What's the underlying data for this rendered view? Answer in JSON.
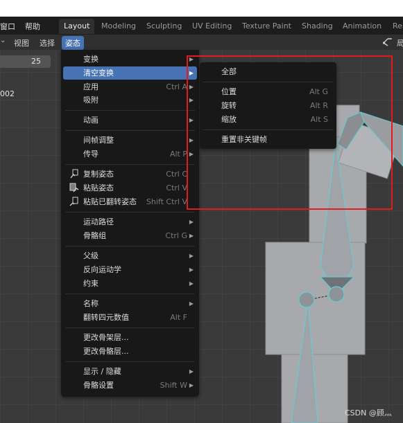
{
  "topbar": {
    "window_menu": "窗口",
    "help_menu": "帮助",
    "workspace_tabs": [
      "Layout",
      "Modeling",
      "Sculpting",
      "UV Editing",
      "Texture Paint",
      "Shading",
      "Animation",
      "Ren"
    ]
  },
  "header": {
    "view": "视图",
    "select": "选择",
    "pose": "姿态",
    "right_label": "局"
  },
  "viewport": {
    "frame_value": "25",
    "side_label": "002"
  },
  "pose_menu": {
    "items": [
      {
        "label": "变换",
        "shortcut": "",
        "submenu": true
      },
      {
        "label": "清空变换",
        "shortcut": "",
        "submenu": true,
        "highlighted": true
      },
      {
        "label": "应用",
        "shortcut": "Ctrl A",
        "submenu": true
      },
      {
        "label": "吸附",
        "shortcut": "",
        "submenu": true
      },
      {
        "label": "动画",
        "shortcut": "",
        "submenu": true
      },
      {
        "label": "间帧调整",
        "shortcut": "",
        "submenu": true
      },
      {
        "label": "传导",
        "shortcut": "Alt P",
        "submenu": true
      },
      {
        "label": "复制姿态",
        "shortcut": "Ctrl C",
        "submenu": false,
        "icon": "copy-pose-icon"
      },
      {
        "label": "粘贴姿态",
        "shortcut": "Ctrl V",
        "submenu": false,
        "icon": "paste-pose-icon"
      },
      {
        "label": "粘贴已翻转姿态",
        "shortcut": "Shift Ctrl V",
        "submenu": false,
        "icon": "paste-flipped-icon"
      },
      {
        "label": "运动路径",
        "shortcut": "",
        "submenu": true
      },
      {
        "label": "骨骼组",
        "shortcut": "Ctrl G",
        "submenu": true
      },
      {
        "label": "父级",
        "shortcut": "",
        "submenu": true
      },
      {
        "label": "反向运动学",
        "shortcut": "",
        "submenu": true
      },
      {
        "label": "约束",
        "shortcut": "",
        "submenu": true
      },
      {
        "label": "名称",
        "shortcut": "",
        "submenu": true
      },
      {
        "label": "翻转四元数值",
        "shortcut": "Alt F",
        "submenu": false
      },
      {
        "label": "更改骨架层...",
        "shortcut": "",
        "submenu": false
      },
      {
        "label": "更改骨骼层...",
        "shortcut": "",
        "submenu": false
      },
      {
        "label": "显示 / 隐藏",
        "shortcut": "",
        "submenu": true
      },
      {
        "label": "骨骼设置",
        "shortcut": "Shift W",
        "submenu": true
      }
    ]
  },
  "clear_transform_submenu": {
    "items": [
      {
        "label": "全部",
        "shortcut": ""
      },
      {
        "label": "位置",
        "shortcut": "Alt G"
      },
      {
        "label": "旋转",
        "shortcut": "Alt R"
      },
      {
        "label": "缩放",
        "shortcut": "Alt S"
      },
      {
        "label": "重置非关键帧",
        "shortcut": ""
      }
    ]
  },
  "watermark": "CSDN @顾灬",
  "colors": {
    "accent": "#4772b3",
    "menu_bg": "#181818",
    "highlight_box": "#e21c1c",
    "bone_outline": "#5fd0d8"
  }
}
